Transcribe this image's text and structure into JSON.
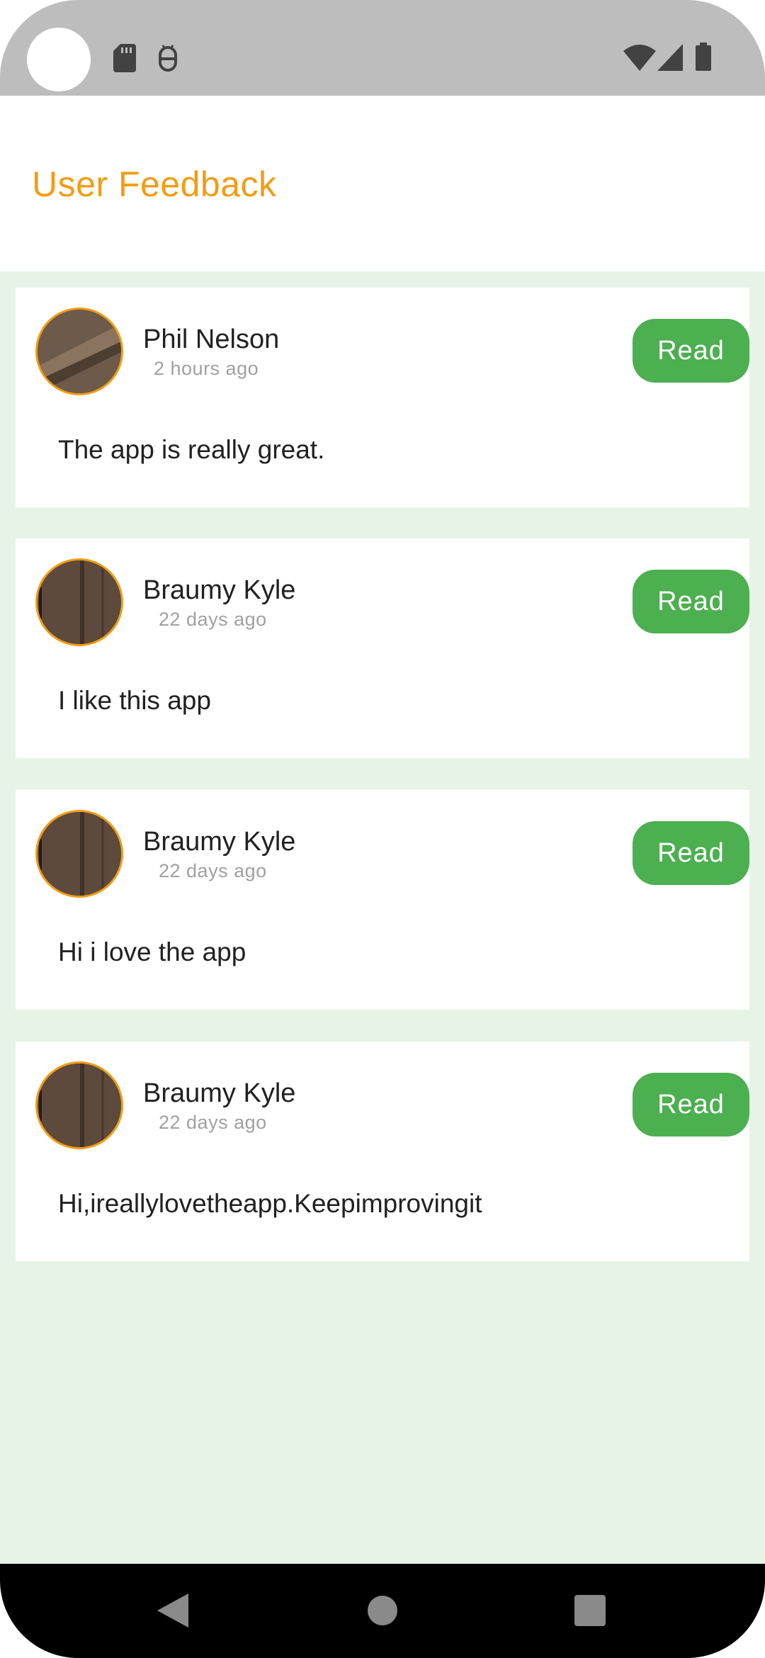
{
  "status_bar": {
    "icons": [
      "sd-card-icon",
      "android-debug-icon",
      "wifi-icon",
      "signal-icon",
      "battery-icon"
    ]
  },
  "header": {
    "title": "User Feedback"
  },
  "feedback": [
    {
      "name": "Phil Nelson",
      "time": "2 hours ago",
      "message": "The app is really great.",
      "action": "Read"
    },
    {
      "name": "Braumy Kyle",
      "time": "22 days ago",
      "message": "I like this app",
      "action": "Read"
    },
    {
      "name": "Braumy Kyle",
      "time": "22 days ago",
      "message": "Hi i love the app",
      "action": "Read"
    },
    {
      "name": "Braumy Kyle",
      "time": "22 days ago",
      "message": "Hi,ireallylovetheapp.Keepimprovingit",
      "action": "Read"
    }
  ],
  "nav_bar": {
    "buttons": [
      "back-icon",
      "home-icon",
      "recents-icon"
    ]
  },
  "colors": {
    "accent": "#f39c12",
    "read_button": "#4caf50",
    "feed_background": "#e6f4e7",
    "status_bar": "#bdbdbd"
  }
}
